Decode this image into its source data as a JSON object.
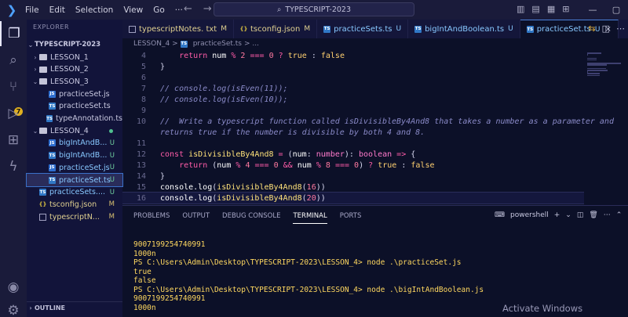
{
  "titlebar": {
    "menu": [
      "File",
      "Edit",
      "Selection",
      "View",
      "Go"
    ],
    "more": "···",
    "search": "TYPESCRIPT-2023"
  },
  "sidebar": {
    "header": "EXPLORER",
    "root": "TYPESCRIPT-2023",
    "tree": [
      {
        "label": "LESSON_1",
        "kind": "folder",
        "open": false,
        "level": 1
      },
      {
        "label": "LESSON_2",
        "kind": "folder",
        "open": false,
        "level": 1
      },
      {
        "label": "LESSON_3",
        "kind": "folder",
        "open": true,
        "level": 1
      },
      {
        "label": "practiceSet.js",
        "kind": "js",
        "level": 2
      },
      {
        "label": "practiceSet.ts",
        "kind": "ts",
        "level": 2
      },
      {
        "label": "typeAnnotation.ts",
        "kind": "ts",
        "level": 2
      },
      {
        "label": "LESSON_4",
        "kind": "folder",
        "open": true,
        "level": 1,
        "status": "dot"
      },
      {
        "label": "bigIntAndB...",
        "kind": "js",
        "level": 2,
        "status": "U"
      },
      {
        "label": "bigIntAndB...",
        "kind": "ts",
        "level": 2,
        "status": "U"
      },
      {
        "label": "practiceSet.js",
        "kind": "js",
        "level": 2,
        "status": "U"
      },
      {
        "label": "practiceSet.ts",
        "kind": "ts",
        "level": 2,
        "status": "U",
        "selected": true
      },
      {
        "label": "practiceSets....",
        "kind": "ts",
        "level": 1,
        "status": "U"
      },
      {
        "label": "tsconfig.json",
        "kind": "json",
        "level": 1,
        "status": "M"
      },
      {
        "label": "typescriptN...",
        "kind": "txt",
        "level": 1,
        "status": "M"
      }
    ],
    "outline": "OUTLINE"
  },
  "tabs": [
    {
      "label": "typescriptNotes. txt",
      "status": "M",
      "active": false
    },
    {
      "label": "tsconfig.json",
      "status": "M",
      "active": false
    },
    {
      "label": "practiceSets.ts",
      "status": "U",
      "active": false
    },
    {
      "label": "bigIntAndBoolean.ts",
      "status": "U",
      "active": false
    },
    {
      "label": "practiceSet.ts",
      "status": "U",
      "active": true,
      "close": "×"
    }
  ],
  "breadcrumb": {
    "folder": "LESSON_4",
    "sep": ">",
    "file": "practiceSet.ts",
    "more": "> ..."
  },
  "editor": {
    "lines": [
      {
        "n": "4",
        "text": "    return num % 2 === 0 ? true : false"
      },
      {
        "n": "5",
        "text": "}"
      },
      {
        "n": "6",
        "text": ""
      },
      {
        "n": "7",
        "text": "// console.log(isEven(11));"
      },
      {
        "n": "8",
        "text": "// console.log(isEven(10));"
      },
      {
        "n": "9",
        "text": ""
      },
      {
        "n": "10",
        "text": "//  Write a typescript function called isDivisibleBy4And8 that takes a number as a parameter and"
      },
      {
        "n": "",
        "text": "returns true if the number is divisible by both 4 and 8."
      },
      {
        "n": "11",
        "text": ""
      },
      {
        "n": "12",
        "text": "const isDivisibleBy4And8 = (num: number): boolean => {"
      },
      {
        "n": "13",
        "text": "    return (num % 4 === 0 && num % 8 === 0) ? true : false"
      },
      {
        "n": "14",
        "text": "}"
      },
      {
        "n": "15",
        "text": "console.log(isDivisibleBy4And8(16))"
      },
      {
        "n": "16",
        "text": "console.log(isDivisibleBy4And8(20))"
      }
    ]
  },
  "panel": {
    "tabs": [
      "PROBLEMS",
      "OUTPUT",
      "DEBUG CONSOLE",
      "TERMINAL",
      "PORTS"
    ],
    "active_tab": "TERMINAL",
    "shell": "powershell",
    "terminal": [
      "9007199254740991",
      "1000n",
      "PS C:\\Users\\Admin\\Desktop\\TYPESCRIPT-2023\\LESSON_4> node .\\practiceSet.js",
      "true",
      "false",
      "PS C:\\Users\\Admin\\Desktop\\TYPESCRIPT-2023\\LESSON_4> node .\\bigIntAndBoolean.js",
      "9007199254740991",
      "1000n"
    ]
  },
  "watermark": "Activate Windows",
  "badges": {
    "source_control": "7"
  }
}
